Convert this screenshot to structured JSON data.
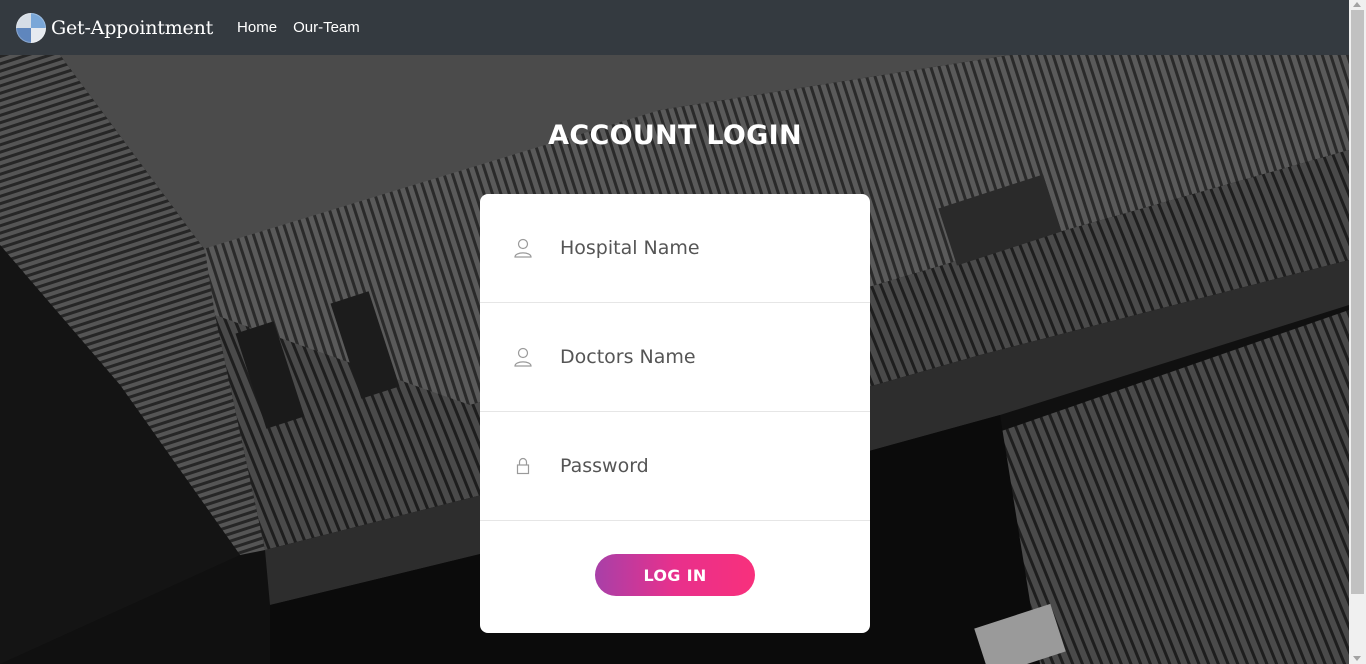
{
  "navbar": {
    "brand": "Get-Appointment",
    "brand_logo_icon": "globe-logo-icon",
    "links": [
      {
        "label": "Home"
      },
      {
        "label": "Our-Team"
      }
    ]
  },
  "login": {
    "title": "ACCOUNT LOGIN",
    "fields": [
      {
        "placeholder": "Hospital Name",
        "icon": "user-icon"
      },
      {
        "placeholder": "Doctors Name",
        "icon": "user-icon"
      },
      {
        "placeholder": "Password",
        "icon": "lock-icon"
      }
    ],
    "button_label": "LOG IN"
  },
  "colors": {
    "navbar_bg": "#343a40",
    "button_gradient_start": "#a840a8",
    "button_gradient_end": "#f8307c"
  }
}
